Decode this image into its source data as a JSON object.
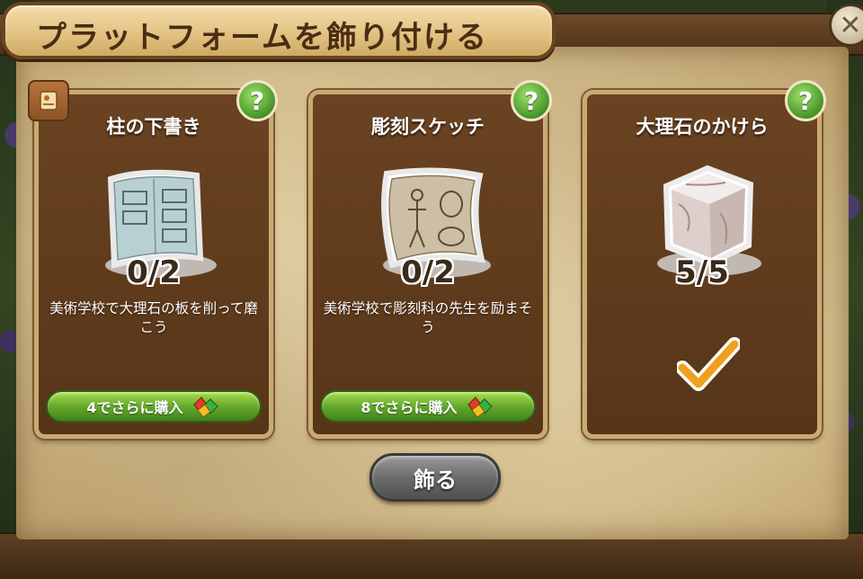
{
  "dialog": {
    "title": "プラットフォームを飾り付ける",
    "close_icon": "close-icon"
  },
  "cards": [
    {
      "title": "柱の下書き",
      "count": "0/2",
      "description": "美術学校で大理石の板を削って磨こう",
      "buy_label": "4でさらに購入",
      "icon": "blueprint-icon",
      "complete": false
    },
    {
      "title": "彫刻スケッチ",
      "count": "0/2",
      "description": "美術学校で彫刻科の先生を励まそう",
      "buy_label": "8でさらに購入",
      "icon": "sketch-scroll-icon",
      "complete": false
    },
    {
      "title": "大理石のかけら",
      "count": "5/5",
      "icon": "marble-block-icon",
      "complete": true
    }
  ],
  "decorate_button": {
    "label": "飾る"
  },
  "colors": {
    "card_bg": "#5e3a1c",
    "parchment": "#e0cc9c",
    "buy_button": "#5fa52a",
    "help_button": "#4c9a2a",
    "decorate_button": "#6b6b6b",
    "checkmark": "#f0a020"
  }
}
